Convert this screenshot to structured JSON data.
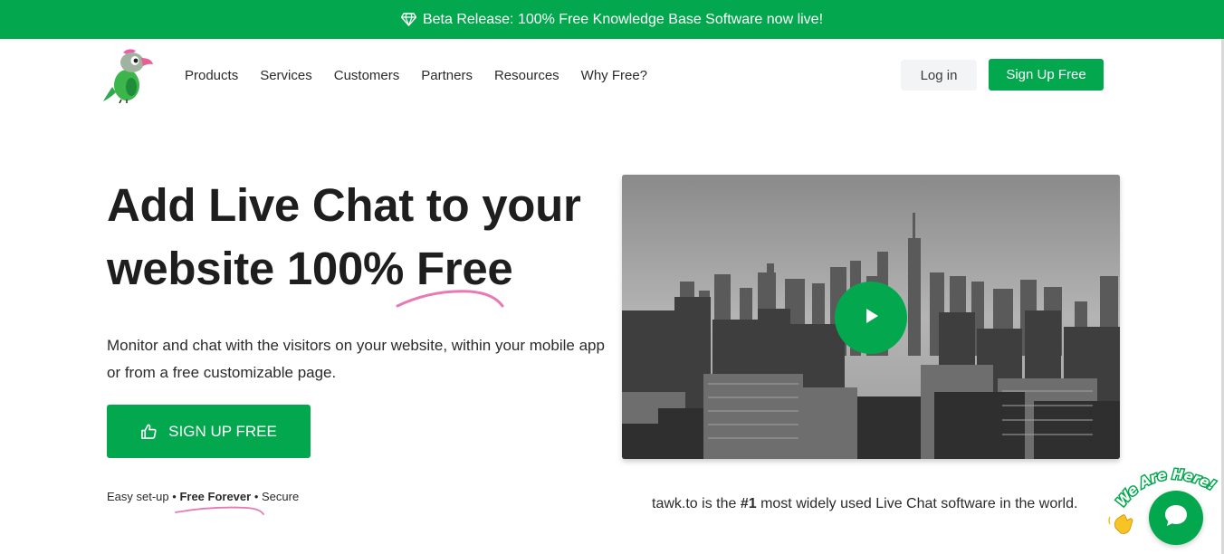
{
  "announcement": {
    "icon": "diamond-icon",
    "text": "Beta Release: 100% Free Knowledge Base Software now live!"
  },
  "header": {
    "logo": "tawk.to parrot logo",
    "nav": [
      "Products",
      "Services",
      "Customers",
      "Partners",
      "Resources",
      "Why Free?"
    ],
    "login_label": "Log in",
    "signup_label": "Sign Up Free"
  },
  "hero": {
    "title_line1": "Add Live Chat to your",
    "title_line2_prefix": "website 100% ",
    "title_line2_highlight": "Free",
    "description": "Monitor and chat with the visitors on your website, within your mobile app or from a free customizable page.",
    "cta_label": "SIGN UP FREE",
    "cta_icon": "thumbs-up-icon",
    "tagline_part1": "Easy set-up",
    "tagline_sep": " • ",
    "tagline_part2": "Free Forever",
    "tagline_part3": "Secure"
  },
  "video": {
    "image": "city-skyline-photo",
    "play_icon": "play-icon"
  },
  "stat": {
    "prefix": "tawk.to is the ",
    "highlight": "#1",
    "suffix": " most widely used Live Chat software in the world."
  },
  "chat_widget": {
    "badge_text": "We Are Here!",
    "icon": "chat-bubble-icon",
    "wave_icon": "waving-hand-icon"
  },
  "colors": {
    "brand_green": "#03a84e",
    "accent_pink": "#e879b4"
  }
}
